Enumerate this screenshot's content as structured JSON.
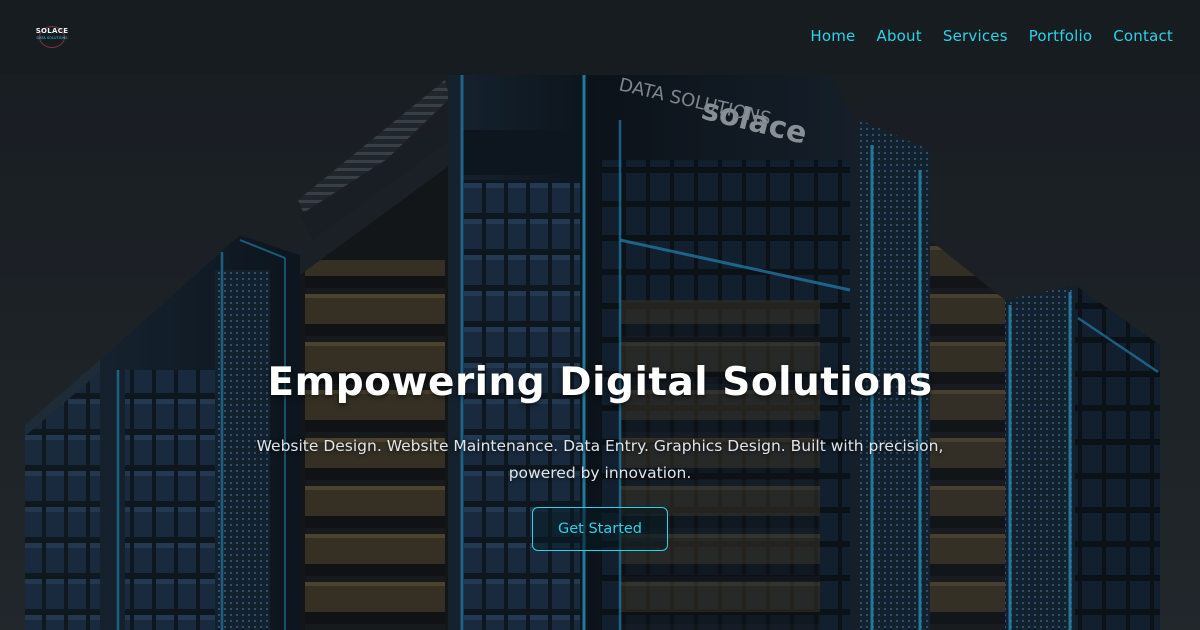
{
  "brand": {
    "logo_name": "SOLACE",
    "logo_tagline": "DATA SOLUTIONS"
  },
  "nav": {
    "items": [
      {
        "label": "Home"
      },
      {
        "label": "About"
      },
      {
        "label": "Services"
      },
      {
        "label": "Portfolio"
      },
      {
        "label": "Contact"
      }
    ]
  },
  "hero": {
    "title": "Empowering Digital Solutions",
    "subtitle": "Website Design. Website Maintenance. Data Entry. Graphics Design. Built with precision, powered by innovation.",
    "cta_label": "Get Started",
    "building_sign_top": "solace",
    "building_sign_bottom": "DATA SOLUTIONS"
  },
  "colors": {
    "accent": "#2cd2e8",
    "navbar": "#181c20",
    "title": "#ffffff",
    "subtitle": "#dfe5ea",
    "building_glow": "#2a9fd6"
  }
}
